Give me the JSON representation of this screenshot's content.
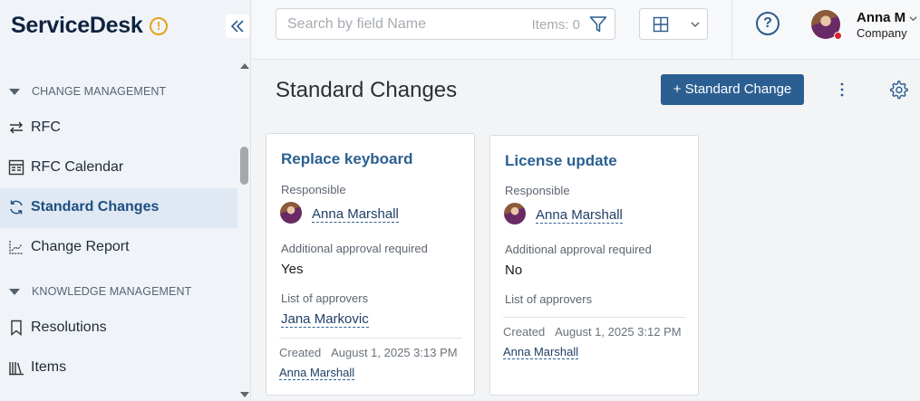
{
  "brand": {
    "name": "ServiceDesk",
    "badge": "!"
  },
  "sidebar": {
    "groups": [
      {
        "label": "CHANGE MANAGEMENT"
      },
      {
        "label": "KNOWLEDGE MANAGEMENT"
      }
    ],
    "items": [
      {
        "label": "RFC",
        "icon": "arrows-swap-icon"
      },
      {
        "label": "RFC Calendar",
        "icon": "calendar-grid-icon"
      },
      {
        "label": "Standard Changes",
        "icon": "refresh-icon",
        "active": true
      },
      {
        "label": "Change Report",
        "icon": "chart-icon"
      },
      {
        "label": "Resolutions",
        "icon": "bookmark-icon"
      },
      {
        "label": "Items",
        "icon": "books-icon"
      }
    ]
  },
  "topbar": {
    "search_placeholder": "Search by field Name",
    "items_count": "Items: 0",
    "help": "?",
    "user": {
      "name": "Anna M",
      "company": "Company"
    }
  },
  "main": {
    "title": "Standard Changes",
    "add_button": "+ Standard Change",
    "labels": {
      "responsible": "Responsible",
      "approval": "Additional approval required",
      "approvers": "List of approvers",
      "created": "Created"
    },
    "cards": [
      {
        "title": "Replace keyboard",
        "responsible": "Anna Marshall",
        "approval": "Yes",
        "approvers": "Jana Markovic",
        "created_at": "August 1, 2025 3:13 PM",
        "created_by": "Anna Marshall"
      },
      {
        "title": "License update",
        "responsible": "Anna Marshall",
        "approval": "No",
        "approvers": "",
        "created_at": "August 1, 2025 3:12 PM",
        "created_by": "Anna Marshall"
      }
    ]
  },
  "colors": {
    "accent": "#2b5f91",
    "brand_text": "#10233f",
    "warning": "#e8a21a",
    "presence": "#d9242b"
  }
}
